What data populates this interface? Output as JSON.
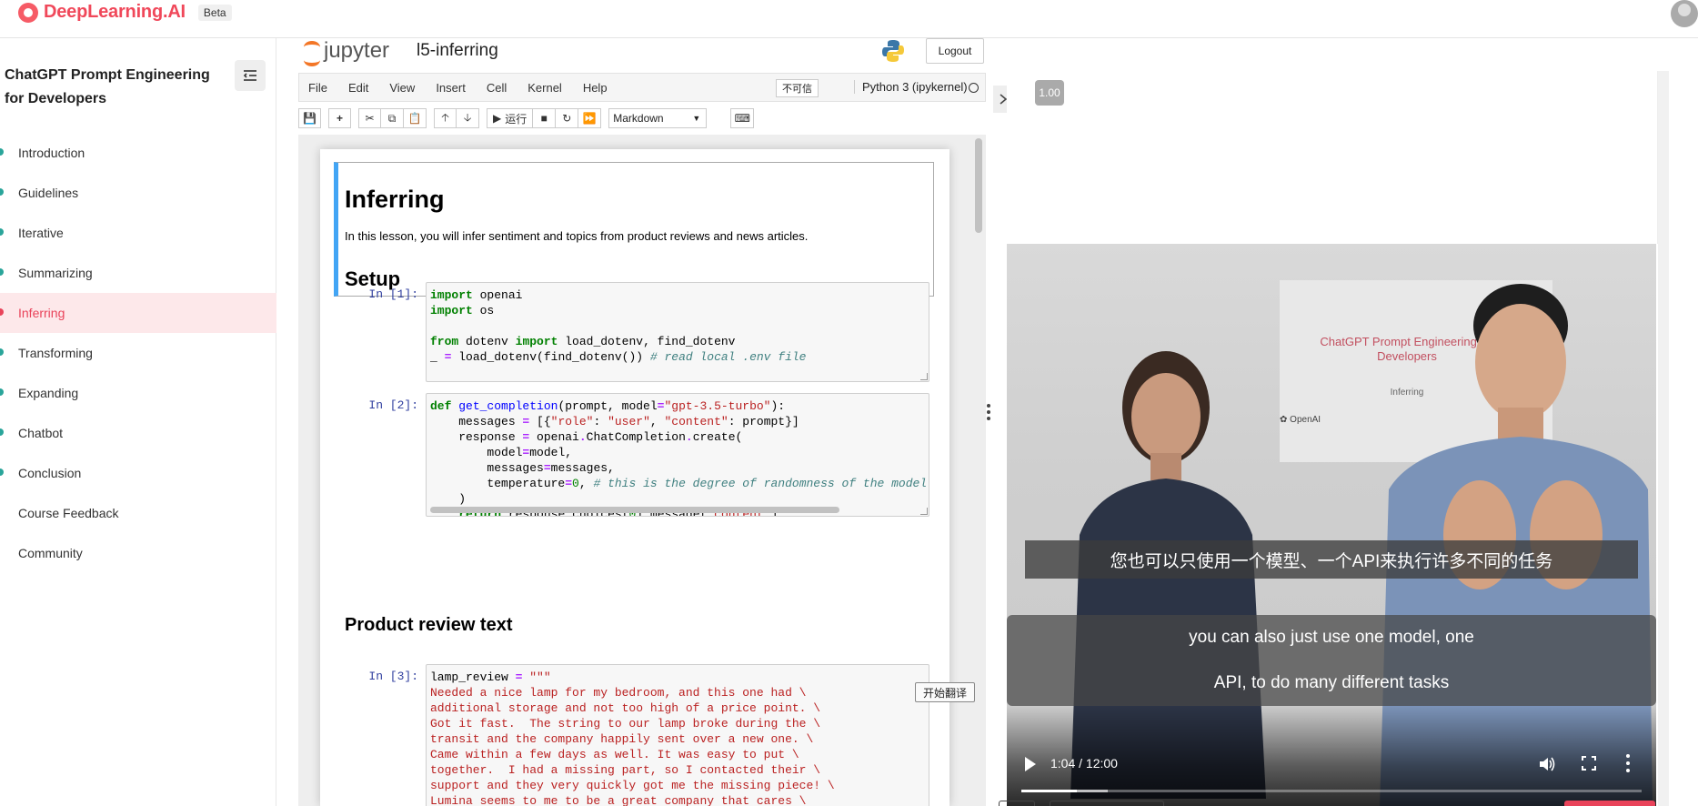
{
  "brand": {
    "name": "DeepLearning.AI",
    "badge": "Beta"
  },
  "sidebar": {
    "course_title": "ChatGPT Prompt Engineering for Developers",
    "items": [
      {
        "label": "Introduction"
      },
      {
        "label": "Guidelines"
      },
      {
        "label": "Iterative"
      },
      {
        "label": "Summarizing"
      },
      {
        "label": "Inferring",
        "active": true
      },
      {
        "label": "Transforming"
      },
      {
        "label": "Expanding"
      },
      {
        "label": "Chatbot"
      },
      {
        "label": "Conclusion"
      },
      {
        "label": "Course Feedback"
      },
      {
        "label": "Community"
      }
    ],
    "accent_color": "#e9435a",
    "dot_color": "#2aa59a"
  },
  "jupyter": {
    "logo_text": "jupyter",
    "notebook_name": "l5-inferring",
    "logout_label": "Logout",
    "menu": [
      "File",
      "Edit",
      "View",
      "Insert",
      "Cell",
      "Kernel",
      "Help"
    ],
    "untrusted_label": "不可信",
    "kernel_name": "Python 3 (ipykernel)",
    "toolbar": {
      "run_label": "运行",
      "cell_type": "Markdown"
    },
    "markdown": {
      "h1": "Inferring",
      "intro": "In this lesson, you will infer sentiment and topics from product reviews and news articles.",
      "setup": "Setup",
      "product_review_heading": "Product review text"
    },
    "cells": [
      {
        "prompt": "In [1]:"
      },
      {
        "prompt": "In [2]:"
      },
      {
        "prompt": "In [3]:"
      }
    ],
    "translate_button": "开始翻译"
  },
  "video": {
    "speed": "1.00",
    "slide_title": "ChatGPT Prompt Engineering for Developers",
    "slide_subtitle": "Inferring",
    "slide_logo": "OpenAI",
    "subtitle_zh": "您也可以只使用一个模型、一个API来执行许多不同的任务",
    "subtitle_en_line1": "you can also just use one model, one",
    "subtitle_en_line2": "API, to do many different tasks",
    "time": "1:04 / 12:00",
    "progress_fraction": 0.089,
    "buffered_fraction": 0.14
  }
}
